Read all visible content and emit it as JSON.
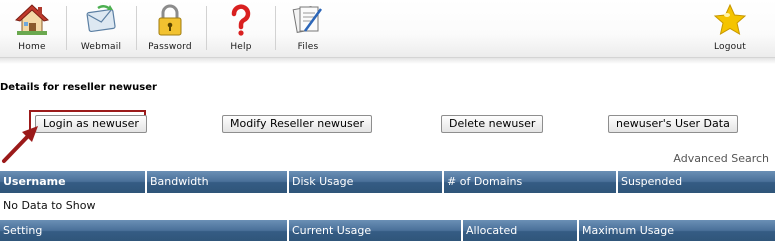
{
  "toolbar": {
    "items": [
      {
        "label": "Home",
        "icon": "home-icon"
      },
      {
        "label": "Webmail",
        "icon": "mail-icon"
      },
      {
        "label": "Password",
        "icon": "lock-icon"
      },
      {
        "label": "Help",
        "icon": "help-icon"
      },
      {
        "label": "Files",
        "icon": "files-icon"
      },
      {
        "label": "Logout",
        "icon": "star-icon"
      }
    ]
  },
  "page": {
    "title": "Details for reseller newuser"
  },
  "actions": {
    "login": "Login as newuser",
    "modify": "Modify Reseller newuser",
    "delete": "Delete newuser",
    "user_data": "newuser's User Data"
  },
  "advanced_search": "Advanced Search",
  "users_table": {
    "columns": [
      "Username",
      "Bandwidth",
      "Disk Usage",
      "# of Domains",
      "Suspended"
    ],
    "empty_message": "No Data to Show"
  },
  "usage_table": {
    "columns": [
      "Setting",
      "Current Usage",
      "Allocated",
      "Maximum Usage"
    ]
  },
  "colors": {
    "header_bar": "#4a7099",
    "highlight": "#9b1a1a",
    "help_red": "#d92020",
    "star_yellow": "#f5c400"
  }
}
